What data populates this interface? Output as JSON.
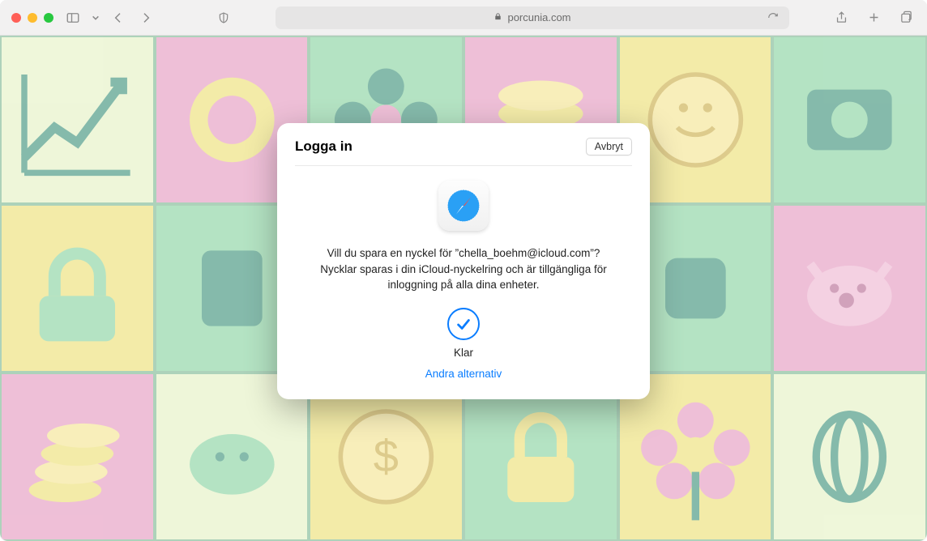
{
  "toolbar": {
    "url_display": "porcunia.com"
  },
  "dialog": {
    "title": "Logga in",
    "cancel_label": "Avbryt",
    "prompt_text": "Vill du spara en nyckel för ”chella_boehm@icloud.com”? Nycklar sparas i din iCloud-nyckelring och är tillgängliga för inloggning på alla dina enheter.",
    "status_label": "Klar",
    "other_options_label": "Andra alternativ"
  },
  "colors": {
    "accent_blue": "#0a7dff",
    "bg_green": "#7fd49b",
    "bg_pink": "#e993be",
    "bg_yellow": "#f2e36a"
  }
}
